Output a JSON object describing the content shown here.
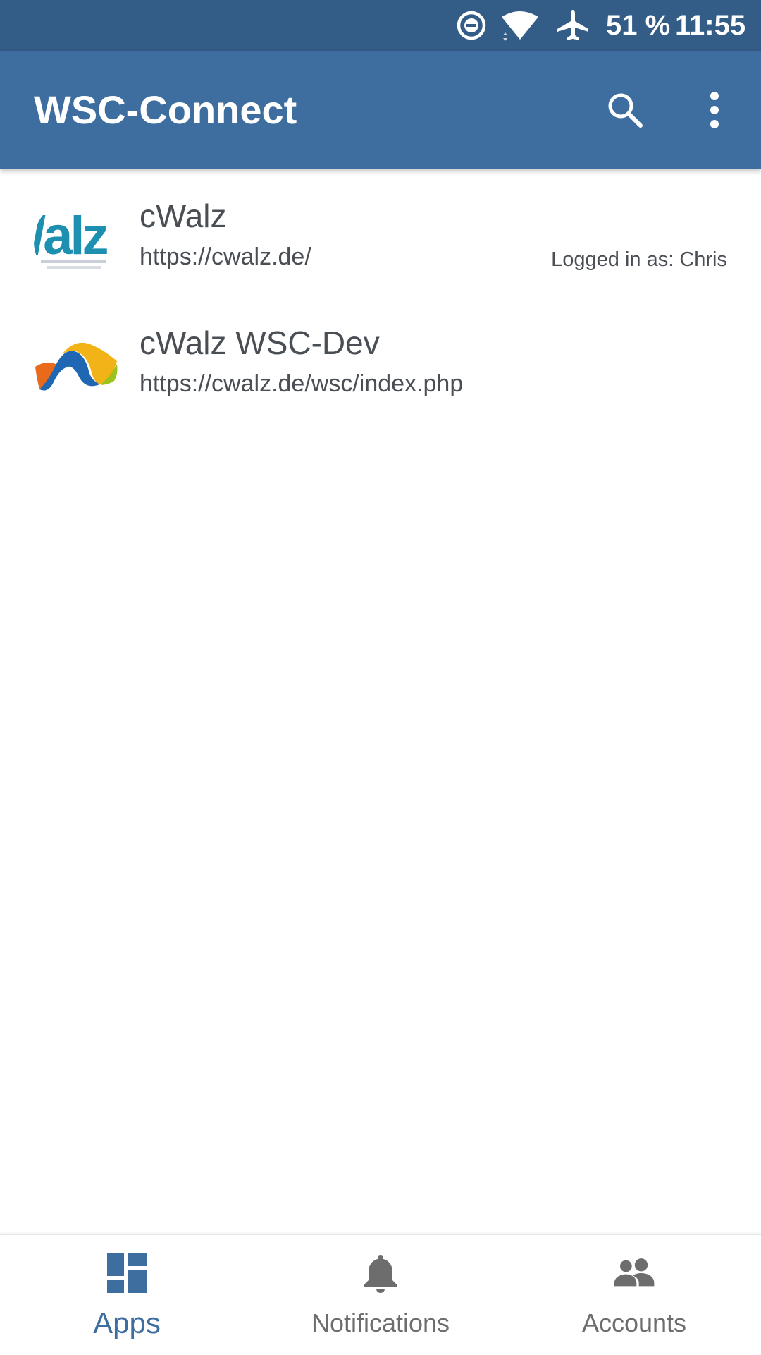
{
  "status_bar": {
    "battery": "51 %",
    "time": "11:55",
    "icons": [
      "do-not-disturb-icon",
      "wifi-icon",
      "airplane-icon"
    ]
  },
  "app_bar": {
    "title": "WSC-Connect",
    "actions": [
      "search-icon",
      "more-vert-icon"
    ]
  },
  "apps": [
    {
      "name": "cWalz",
      "url": "https://cwalz.de/",
      "status": "Logged in as: Chris",
      "avatar": "cwalz-logo"
    },
    {
      "name": "cWalz WSC-Dev",
      "url": "https://cwalz.de/wsc/index.php",
      "status": "",
      "avatar": "wsc-logo"
    }
  ],
  "bottom_nav": {
    "items": [
      {
        "label": "Apps",
        "icon": "dashboard-icon",
        "active": true
      },
      {
        "label": "Notifications",
        "icon": "bell-icon",
        "active": false
      },
      {
        "label": "Accounts",
        "icon": "people-icon",
        "active": false
      }
    ]
  },
  "colors": {
    "status_bar": "#335c87",
    "primary": "#3e6d9f",
    "text": "#4a4f56",
    "inactive_nav": "#6d6d6d"
  }
}
